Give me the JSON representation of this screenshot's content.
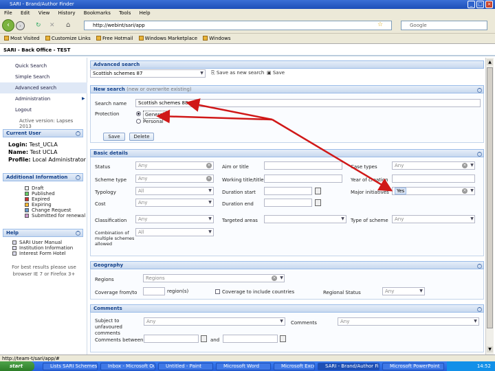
{
  "window": {
    "title": "SARI - Brand/Author Finder"
  },
  "menu": [
    "File",
    "Edit",
    "View",
    "History",
    "Bookmarks",
    "Tools",
    "Help"
  ],
  "nav": {
    "url": "http://webint/sari/app",
    "search_placeholder": "Google"
  },
  "bookmarks": [
    "Most Visited",
    "Customize Links",
    "Free Hotmail",
    "Windows Marketplace",
    "Windows"
  ],
  "app": {
    "header": "SARI - Back Office - TEST"
  },
  "leftnav": {
    "items": [
      "Quick Search",
      "Simple Search",
      "Advanced search",
      "Administration",
      "Logout"
    ],
    "version": "Active version: Lapses 2013"
  },
  "current_user": {
    "title": "Current User",
    "rows": [
      {
        "label": "Login:",
        "value": "Test_UCLA"
      },
      {
        "label": "Name:",
        "value": "Test UCLA"
      },
      {
        "label": "Profile:",
        "value": "Local Administrator"
      }
    ]
  },
  "additional_info": {
    "title": "Additional Information",
    "legend": [
      "Draft",
      "Published",
      "Expired",
      "Expiring",
      "Change Request",
      "Submitted for renewal"
    ]
  },
  "help": {
    "title": "Help",
    "links": [
      "SARI User Manual",
      "Institution Information",
      "Interest Form Hotel"
    ],
    "note": "For best results please use browser IE 7 or Firefox 3+"
  },
  "advanced_search": {
    "title": "Advanced search",
    "saved_search": "Scottish schemes 87",
    "save_as_label": "Save as new search",
    "save_label": "Save"
  },
  "new_search": {
    "title": "New search",
    "subtitle": "(new or overwrite existing)",
    "name_label": "Search name",
    "name_value": "Scottish schemes 88",
    "prot_label": "Protection",
    "option_general": "General",
    "option_personal": "Personal",
    "save_btn": "Save",
    "delete_btn": "Delete"
  },
  "basic_details": {
    "title": "Basic details",
    "status": {
      "label": "Status",
      "value": "Any"
    },
    "scheme_type": {
      "label": "Scheme type",
      "value": "Any"
    },
    "typology": {
      "label": "Typology",
      "value": "All"
    },
    "cost": {
      "label": "Cost",
      "value": "Any"
    },
    "classification": {
      "label": "Classification",
      "value": "Any"
    },
    "combinations": {
      "label": "Combination of multiple schemes allowed",
      "value": "All"
    },
    "aim_title": {
      "label": "Aim or title"
    },
    "working_title": {
      "label": "Working title/title"
    },
    "duration_start": {
      "label": "Duration start"
    },
    "duration_end": {
      "label": "Duration end"
    },
    "target_area": {
      "label": "Targeted areas"
    },
    "case_types": {
      "label": "Case types",
      "value": "Any"
    },
    "year_of_creation": {
      "label": "Year of creation"
    },
    "major_initiatives": {
      "label": "Major initiatives",
      "value": "Yes"
    },
    "type_outline": {
      "label": "Type of scheme",
      "value": "Any"
    }
  },
  "geography": {
    "title": "Geography",
    "regions_label": "Regions",
    "regions_value": "Regions",
    "coverage_label": "Coverage from/to",
    "coverage_unit": "region(s)",
    "national_label": "Coverage to include countries",
    "regional_status_label": "Regional Status",
    "regional_status_value": "Any"
  },
  "comments": {
    "title": "Comments",
    "subject_label": "Subject to unfavoured comments",
    "subject_value": "Any",
    "comments_label": "Comments",
    "comments_value": "Any",
    "between_label": "Comments between",
    "and_label": "and"
  },
  "statusbar": "http://team-t/sari/app/#",
  "taskbar": {
    "start": "start",
    "tasks": [
      "Lists SARI Schemes",
      "Inbox - Microsoft Out...",
      "Untitled - Paint",
      "Microsoft Word",
      "Microsoft Excel",
      "SARI - Brand/Author Finder",
      "Microsoft PowerPoint"
    ],
    "clock": "14:52"
  },
  "colors": {
    "accent": "#15428b",
    "arrow": "#d01818",
    "panel_border": "#99bbe8"
  }
}
